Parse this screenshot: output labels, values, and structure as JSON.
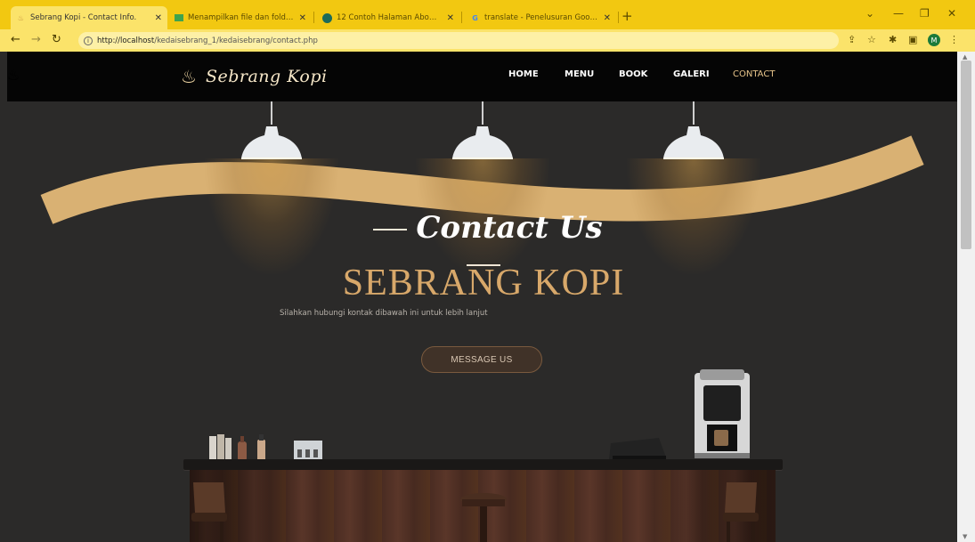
{
  "browser": {
    "tabs": [
      {
        "title": "Sebrang Kopi - Contact Info.",
        "active": true,
        "favicon": "coffee-cup-icon"
      },
      {
        "title": "Menampilkan file dan folder ter",
        "active": false,
        "favicon": "file-icon"
      },
      {
        "title": "12 Contoh Halaman About yang",
        "active": false,
        "favicon": "site-icon"
      },
      {
        "title": "translate - Penelusuran Google",
        "active": false,
        "favicon": "google-icon"
      }
    ],
    "tab_close_glyph": "✕",
    "new_tab_glyph": "+",
    "url_host": "http://localhost",
    "url_path": "/kedaisebrang_1/kedaisebrang/contact.php",
    "profile_initial": "M",
    "colors": {
      "tabstrip": "#f2c811",
      "toolbar": "#fbe36a"
    }
  },
  "site": {
    "logo_text": "Sebrang Kopi",
    "menu": {
      "home": "HOME",
      "menu": "MENU",
      "book": "BOOK",
      "galeri": "GALERI",
      "contact": "CONTACT"
    },
    "hero": {
      "title": "Contact Us",
      "brand": "SEBRANG KOPI",
      "subtitle": "Silahkan hubungi kontak dibawah ini untuk lebih lanjut",
      "button": "MESSAGE US"
    },
    "colors": {
      "background": "#2b2a29",
      "accent": "#d8a86a",
      "nav": "#050505"
    }
  }
}
